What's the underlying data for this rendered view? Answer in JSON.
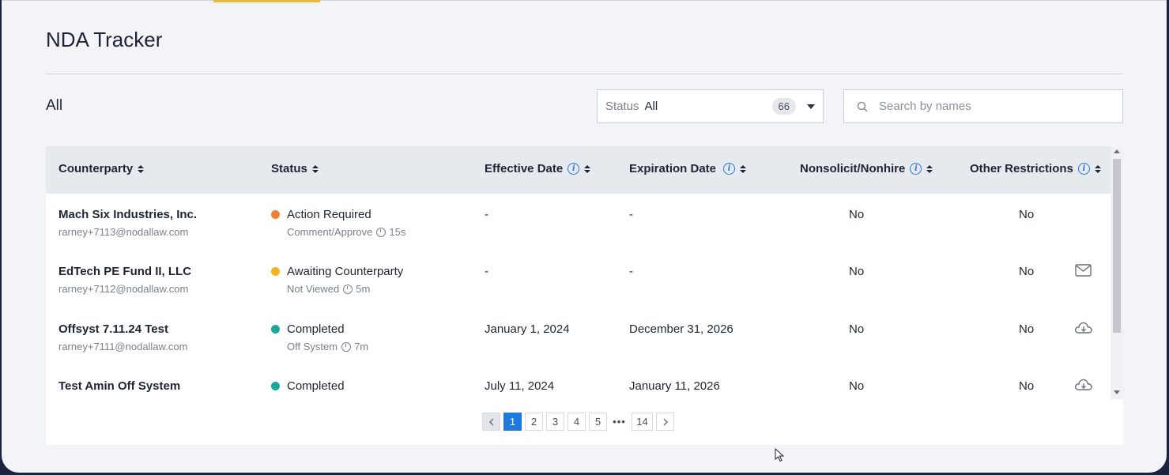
{
  "page": {
    "title": "NDA Tracker",
    "filter_label": "All"
  },
  "status_filter": {
    "label": "Status",
    "value": "All",
    "count": "66"
  },
  "search": {
    "placeholder": "Search by names"
  },
  "table": {
    "columns": [
      "Counterparty",
      "Status",
      "Effective Date",
      "Expiration Date",
      "Nonsolicit/Nonhire",
      "Other Restrictions"
    ],
    "rows": [
      {
        "name": "Mach Six Industries, Inc.",
        "email": "rarney+7113@nodallaw.com",
        "status": "Action Required",
        "status_color": "#f07f34",
        "sub": "Comment/Approve",
        "age": "15s",
        "effective": "-",
        "expiration": "-",
        "nonsolicit": "No",
        "other": "No",
        "action_icon": ""
      },
      {
        "name": "EdTech PE Fund II, LLC",
        "email": "rarney+7112@nodallaw.com",
        "status": "Awaiting Counterparty",
        "status_color": "#f2b41c",
        "sub": "Not Viewed",
        "age": "5m",
        "effective": "-",
        "expiration": "-",
        "nonsolicit": "No",
        "other": "No",
        "action_icon": "mail-icon"
      },
      {
        "name": "Offsyst 7.11.24 Test",
        "email": "rarney+7111@nodallaw.com",
        "status": "Completed",
        "status_color": "#1aa79a",
        "sub": "Off System",
        "age": "7m",
        "effective": "January 1, 2024",
        "expiration": "December 31, 2026",
        "nonsolicit": "No",
        "other": "No",
        "action_icon": "cloud-download-icon"
      },
      {
        "name": "Test Amin Off System",
        "email": "",
        "status": "Completed",
        "status_color": "#1aa79a",
        "sub": "",
        "age": "",
        "effective": "July 11, 2024",
        "expiration": "January 11, 2026",
        "nonsolicit": "No",
        "other": "No",
        "action_icon": "cloud-download-icon"
      }
    ]
  },
  "pagination": {
    "pages": [
      "1",
      "2",
      "3",
      "4",
      "5"
    ],
    "ellipsis": "•••",
    "last": "14",
    "current": "1"
  }
}
